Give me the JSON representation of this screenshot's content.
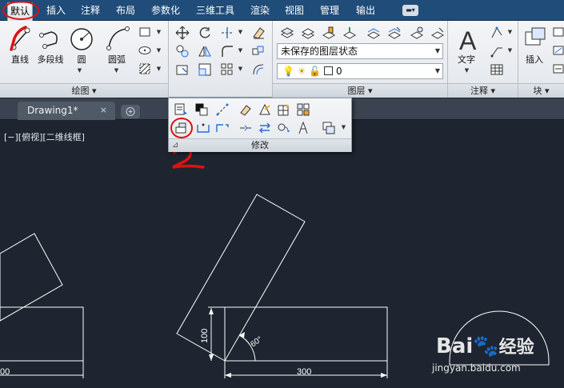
{
  "menu": {
    "tabs": [
      "默认",
      "插入",
      "注释",
      "布局",
      "参数化",
      "三维工具",
      "渲染",
      "视图",
      "管理",
      "输出"
    ],
    "active_tab": "默认"
  },
  "ribbon": {
    "draw_panel": {
      "title": "绘图 ▾",
      "line_label": "直线",
      "polyline_label": "多段线",
      "circle_label": "圆",
      "arc_label": "圆弧"
    },
    "layers_panel": {
      "title": "图层 ▾",
      "layer_state": "未保存的图层状态",
      "current_layer": "0"
    },
    "annotation_panel": {
      "title": "注释 ▾",
      "text_label": "文字"
    },
    "block_panel": {
      "title": "块 ▾",
      "insert_label": "插入"
    }
  },
  "document": {
    "tab_title": "Drawing1*",
    "close_glyph": "×"
  },
  "modify_panel": {
    "title": "修改"
  },
  "viewport": {
    "label": "[−][俯视][二维线框]"
  },
  "drawing": {
    "dim_height": "100",
    "dim_width": "300",
    "dim_angle": "60°",
    "dim_left_partial": "00"
  },
  "annotation": {
    "step_number": "2"
  },
  "watermark": {
    "brand": "Bai",
    "brand_cn": "经验",
    "url": "jingyan.baidu.com"
  },
  "colors": {
    "menubar": "#1f4c79",
    "canvas": "#1e2530",
    "highlight_red": "#e01010",
    "drawing_line": "#ffffff"
  }
}
